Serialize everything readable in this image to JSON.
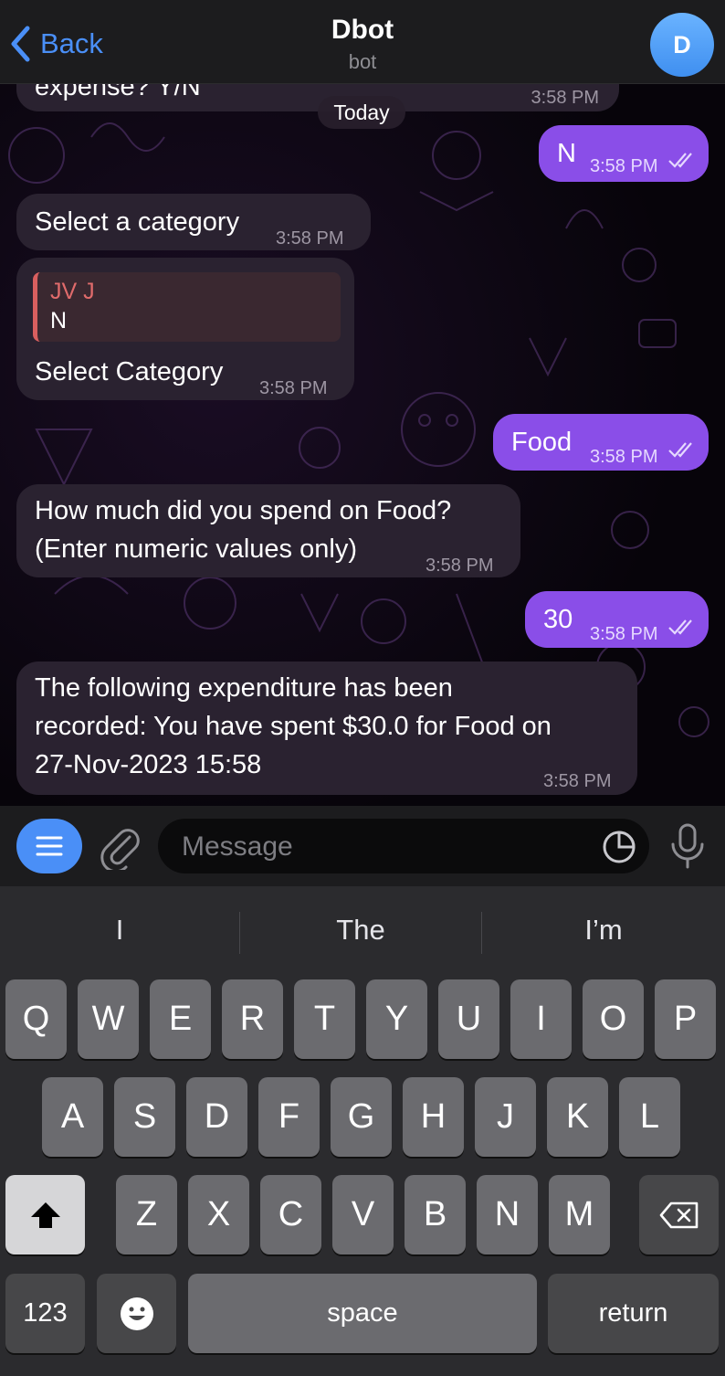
{
  "header": {
    "back_label": "Back",
    "title": "Dbot",
    "subtitle": "bot",
    "avatar_letter": "D"
  },
  "chat": {
    "date_chip": "Today",
    "messages": [
      {
        "dir": "in",
        "text": "expense? Y/N",
        "time": "3:58 PM"
      },
      {
        "dir": "out",
        "text": "N",
        "time": "3:58 PM"
      },
      {
        "dir": "in",
        "text": "Select a category",
        "time": "3:58 PM"
      },
      {
        "dir": "in",
        "reply_author": "JV J",
        "reply_text": "N",
        "text": "Select Category",
        "time": "3:58 PM"
      },
      {
        "dir": "out",
        "text": "Food",
        "time": "3:58 PM"
      },
      {
        "dir": "in",
        "text_line1": "How much did you spend on Food?",
        "text_line2": "(Enter numeric values only)",
        "time": "3:58 PM"
      },
      {
        "dir": "out",
        "text": "30",
        "time": "3:58 PM"
      },
      {
        "dir": "in",
        "text_line1": "The following expenditure has been",
        "text_line2": "recorded: You have spent $30.0 for Food on",
        "text_line3": "27-Nov-2023 15:58",
        "time": "3:58 PM"
      }
    ]
  },
  "input": {
    "placeholder": "Message"
  },
  "keyboard": {
    "suggestions": [
      "I",
      "The",
      "I’m"
    ],
    "row1": [
      "Q",
      "W",
      "E",
      "R",
      "T",
      "Y",
      "U",
      "I",
      "O",
      "P"
    ],
    "row2": [
      "A",
      "S",
      "D",
      "F",
      "G",
      "H",
      "J",
      "K",
      "L"
    ],
    "row3": [
      "Z",
      "X",
      "C",
      "V",
      "B",
      "N",
      "M"
    ],
    "numbers_label": "123",
    "space_label": "space",
    "return_label": "return"
  },
  "colors": {
    "accent": "#4a8ff7",
    "outgoing_bubble": "#8a4ee8",
    "incoming_bubble": "#2a2230"
  }
}
